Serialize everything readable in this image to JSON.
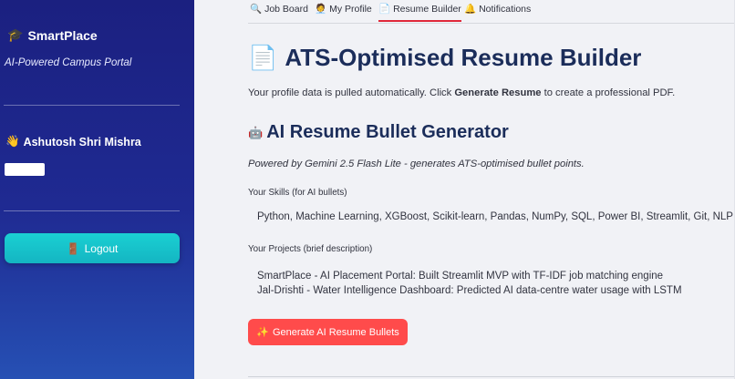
{
  "sidebar": {
    "brand_icon": "🎓",
    "brand": "SmartPlace",
    "tagline": "AI-Powered Campus Portal",
    "user_icon": "👋",
    "user_name": "Ashutosh Shri Mishra",
    "logout_icon": "🚪",
    "logout_label": "Logout"
  },
  "tabs": [
    {
      "icon": "🔍",
      "label": "Job Board"
    },
    {
      "icon": "🧑‍💼",
      "label": "My Profile"
    },
    {
      "icon": "📄",
      "label": "Resume Builder"
    },
    {
      "icon": "🔔",
      "label": "Notifications"
    }
  ],
  "main": {
    "title_icon": "📄",
    "title": "ATS-Optimised Resume Builder",
    "intro_pre": "Your profile data is pulled automatically. Click ",
    "intro_bold": "Generate Resume",
    "intro_post": " to create a professional PDF.",
    "section_icon": "🤖",
    "section_title": "AI Resume Bullet Generator",
    "powered_by": "Powered by Gemini 2.5 Flash Lite - generates ATS-optimised bullet points.",
    "skills_label": "Your Skills (for AI bullets)",
    "skills_value": "Python, Machine Learning, XGBoost, Scikit-learn, Pandas, NumPy, SQL, Power BI, Streamlit, Git, NLP",
    "projects_label": "Your Projects (brief description)",
    "projects_lines": [
      "SmartPlace - AI Placement Portal: Built Streamlit MVP with TF-IDF job matching engine",
      "Jal-Drishti - Water Intelligence Dashboard: Predicted AI data-centre water usage with LSTM"
    ],
    "generate_icon": "✨",
    "generate_label": "Generate AI Resume Bullets"
  },
  "colors": {
    "sidebar_top": "#1b2080",
    "sidebar_bottom": "#2650b4",
    "logout_button": "#17c3ca",
    "heading": "#1b2d5a",
    "primary_button": "#ff4b4b",
    "active_tab_underline": "#e0283a"
  }
}
